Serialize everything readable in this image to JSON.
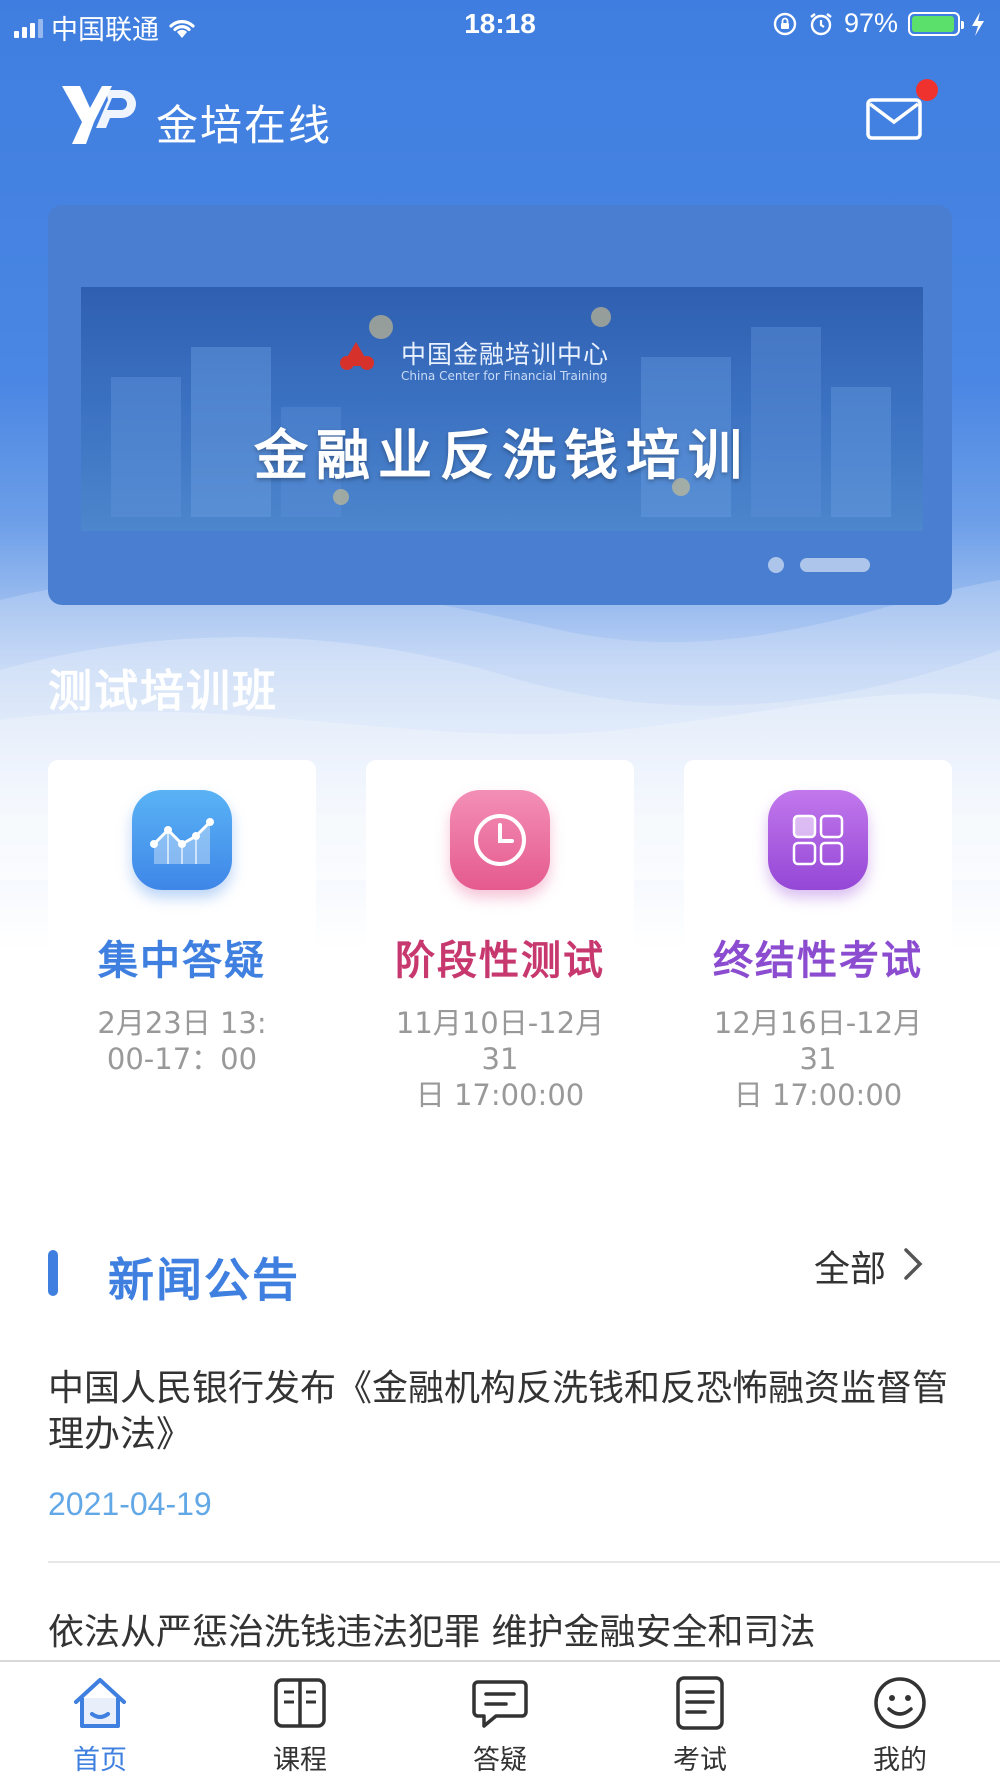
{
  "status_bar": {
    "carrier": "中国联通",
    "time": "18:18",
    "battery_percent": "97%"
  },
  "header": {
    "app_title": "金培在线",
    "has_unread_mail": true
  },
  "banner": {
    "org_name": "中国金融培训中心",
    "org_name_en": "China Center for Financial Training",
    "title": "金融业反洗钱培训",
    "slide_count": 2,
    "active_slide": 2
  },
  "class_section": {
    "title": "测试培训班"
  },
  "features": [
    {
      "name": "集中答疑",
      "date_line1": "2月23日  13:",
      "date_line2": "00-17：00",
      "color": "#3e7fe0",
      "icon": "chart-icon"
    },
    {
      "name": "阶段性测试",
      "date_line1": "11月10日-12月31",
      "date_line2": "日 17:00:00",
      "color": "#c7386f",
      "icon": "clock-icon"
    },
    {
      "name": "终结性考试",
      "date_line1": "12月16日-12月31",
      "date_line2": "日 17:00:00",
      "color": "#8b4cd0",
      "icon": "grid-icon"
    }
  ],
  "news": {
    "section_title": "新闻公告",
    "all_label": "全部",
    "items": [
      {
        "title": "中国人民银行发布《金融机构反洗钱和反恐怖融资监督管理办法》",
        "date": "2021-04-19"
      },
      {
        "title": "依法从严惩治洗钱违法犯罪 维护金融安全和司法"
      }
    ]
  },
  "tabs": [
    {
      "label": "首页",
      "icon": "home-icon",
      "active": true
    },
    {
      "label": "课程",
      "icon": "book-icon",
      "active": false
    },
    {
      "label": "答疑",
      "icon": "chat-icon",
      "active": false
    },
    {
      "label": "考试",
      "icon": "exam-icon",
      "active": false
    },
    {
      "label": "我的",
      "icon": "smile-icon",
      "active": false
    }
  ],
  "colors": {
    "primary": "#3e7fe0",
    "text": "#333333",
    "muted": "#999999",
    "date": "#62a8e6",
    "badge": "#f0322e"
  }
}
